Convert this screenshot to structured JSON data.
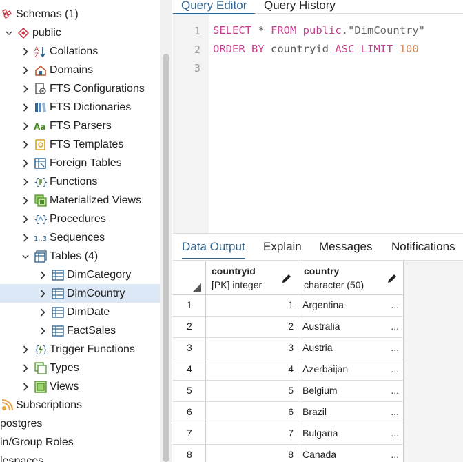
{
  "tree": {
    "items": [
      {
        "label": "Schemas (1)",
        "icon": "schemas-icon",
        "chevron": "",
        "level": 0
      },
      {
        "label": "public",
        "icon": "schema-icon",
        "chevron": "down",
        "level": 1
      },
      {
        "label": "Collations",
        "icon": "collations-icon",
        "chevron": "right",
        "level": 2,
        "selected": false
      },
      {
        "label": "Domains",
        "icon": "domains-icon",
        "chevron": "right",
        "level": 2
      },
      {
        "label": "FTS Configurations",
        "icon": "fts-configurations-icon",
        "chevron": "right",
        "level": 2
      },
      {
        "label": "FTS Dictionaries",
        "icon": "fts-dictionaries-icon",
        "chevron": "right",
        "level": 2
      },
      {
        "label": "FTS Parsers",
        "icon": "fts-parsers-icon",
        "chevron": "right",
        "level": 2
      },
      {
        "label": "FTS Templates",
        "icon": "fts-templates-icon",
        "chevron": "right",
        "level": 2
      },
      {
        "label": "Foreign Tables",
        "icon": "foreign-tables-icon",
        "chevron": "right",
        "level": 2
      },
      {
        "label": "Functions",
        "icon": "functions-icon",
        "chevron": "right",
        "level": 2
      },
      {
        "label": "Materialized Views",
        "icon": "materialized-views-icon",
        "chevron": "right",
        "level": 2
      },
      {
        "label": "Procedures",
        "icon": "procedures-icon",
        "chevron": "right",
        "level": 2
      },
      {
        "label": "Sequences",
        "icon": "sequences-icon",
        "chevron": "right",
        "level": 2
      },
      {
        "label": "Tables (4)",
        "icon": "tables-icon",
        "chevron": "down",
        "level": 2
      },
      {
        "label": "DimCategory",
        "icon": "table-icon",
        "chevron": "right",
        "level": 3
      },
      {
        "label": "DimCountry",
        "icon": "table-icon",
        "chevron": "right",
        "level": 3,
        "selected": true
      },
      {
        "label": "DimDate",
        "icon": "table-icon",
        "chevron": "right",
        "level": 3
      },
      {
        "label": "FactSales",
        "icon": "table-icon",
        "chevron": "right",
        "level": 3
      },
      {
        "label": "Trigger Functions",
        "icon": "trigger-functions-icon",
        "chevron": "right",
        "level": 2
      },
      {
        "label": "Types",
        "icon": "types-icon",
        "chevron": "right",
        "level": 2
      },
      {
        "label": "Views",
        "icon": "views-icon",
        "chevron": "right",
        "level": 2
      },
      {
        "label": "Subscriptions",
        "icon": "subscriptions-icon",
        "chevron": "",
        "level": 0
      },
      {
        "label": "postgres",
        "icon": "",
        "chevron": "",
        "level": -1
      },
      {
        "label": "in/Group Roles",
        "icon": "",
        "chevron": "",
        "level": -1
      },
      {
        "label": "lespaces",
        "icon": "",
        "chevron": "",
        "level": -1
      }
    ]
  },
  "editor": {
    "tabs": [
      "Query Editor",
      "Query History"
    ],
    "active_tab": "Query Editor",
    "line_numbers": [
      "1",
      "2",
      "3"
    ],
    "line1": {
      "kw1": "SELECT",
      "star": " * ",
      "kw2": "FROM",
      "schema": " public",
      "dot": ".",
      "table": "\"DimCountry\""
    },
    "line2": {
      "kw1": "ORDER BY",
      "col": " countryid ",
      "kw2": "ASC",
      "sp": " ",
      "kw3": "LIMIT",
      "sp2": " ",
      "num": "100"
    }
  },
  "results": {
    "tabs": [
      "Data Output",
      "Explain",
      "Messages",
      "Notifications"
    ],
    "active_tab": "Data Output",
    "columns": [
      {
        "name": "countryid",
        "type": "[PK] integer"
      },
      {
        "name": "country",
        "type": "character (50)"
      }
    ],
    "rows": [
      {
        "rn": "1",
        "id": "1",
        "country": "Argentina"
      },
      {
        "rn": "2",
        "id": "2",
        "country": "Australia"
      },
      {
        "rn": "3",
        "id": "3",
        "country": "Austria"
      },
      {
        "rn": "4",
        "id": "4",
        "country": "Azerbaijan"
      },
      {
        "rn": "5",
        "id": "5",
        "country": "Belgium"
      },
      {
        "rn": "6",
        "id": "6",
        "country": "Brazil"
      },
      {
        "rn": "7",
        "id": "7",
        "country": "Bulgaria"
      },
      {
        "rn": "8",
        "id": "8",
        "country": "Canada"
      }
    ],
    "ellipsis": "..."
  },
  "colors": {
    "accent": "#326690",
    "keyword": "#c53e8c",
    "number": "#d08a5a",
    "selected_row": "#dde8f7"
  }
}
